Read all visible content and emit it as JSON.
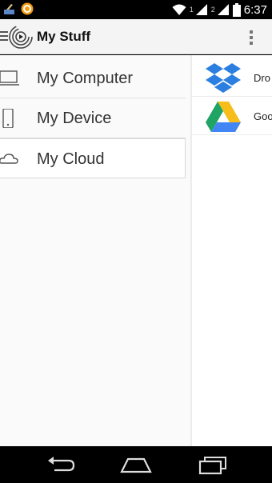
{
  "status_bar": {
    "sim1_label": "1",
    "sim2_label": "2",
    "time": "6:37",
    "icons": [
      "notification-app-icon",
      "notification-orange-icon",
      "wifi-icon",
      "signal-icon",
      "signal-icon",
      "battery-icon"
    ]
  },
  "action_bar": {
    "title": "My Stuff"
  },
  "nav_items": [
    {
      "label": "My Computer",
      "icon": "computer-icon"
    },
    {
      "label": "My Device",
      "icon": "phone-icon"
    },
    {
      "label": "My Cloud",
      "icon": "cloud-icon"
    }
  ],
  "selected_nav": "My Cloud",
  "services": [
    {
      "label": "Dro",
      "icon": "dropbox-icon",
      "color": "#2b7fe0"
    },
    {
      "label": "Goo",
      "icon": "google-drive-icon",
      "color": "#1fa463"
    }
  ],
  "system_nav": {
    "buttons": [
      "back-button",
      "home-button",
      "recent-apps-button"
    ]
  }
}
